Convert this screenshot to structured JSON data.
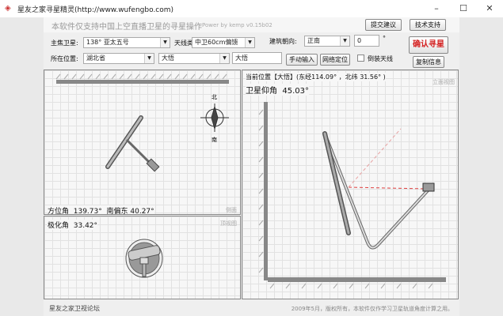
{
  "window": {
    "title": "星友之家寻星精灵(http://www.wufengbo.com)",
    "minimize": "–",
    "maximize": "☐",
    "close": "✕"
  },
  "header": {
    "slogan": "本软件仅支持中国上空直播卫星的寻星操作",
    "power": "Power by kemp  v0.15b02",
    "suggest_button": "提交建议",
    "support_button": "技术支持"
  },
  "controls": {
    "satellite_label": "主焦卫星:",
    "satellite_value": "138°  亚太五号",
    "antenna_label": "天线类型:",
    "antenna_value": "中卫60cm偏馈",
    "facing_label": "建筑朝向:",
    "facing_value": "正南",
    "facing_degree": "0",
    "degree_unit": "°",
    "confirm_button": "确认寻星",
    "location_label": "所在位置:",
    "province_value": "湖北省",
    "city_value": "大悟",
    "city_input": "大悟",
    "manual_button": "手动输入",
    "network_button": "网络定位",
    "inverted_label": "倒装天线",
    "inverted_checked": false,
    "copy_button": "复制信息"
  },
  "side_view": {
    "tag": "侧面",
    "azimuth_label": "方位角",
    "azimuth_value": "139.73°",
    "offset_label": "南偏东",
    "offset_value": "40.27°",
    "compass_n": "北",
    "compass_s": "南"
  },
  "top_view": {
    "tag": "顶视图",
    "polarization_label": "极化角",
    "polarization_value": "33.42°"
  },
  "elevation_view": {
    "tag": "立面视图",
    "location_text": "当前位置【大悟】(东经114.09° ，北纬 31.56° )",
    "elevation_label": "卫星仰角",
    "elevation_value": "45.03°"
  },
  "footer": {
    "forum": "星友之家卫视论坛",
    "copyright": "2009年5月，版权所有，本软件仅作学习卫星轨道角度计算之用。"
  },
  "colors": {
    "confirm_text": "#d42020",
    "arrow": "#e04040"
  }
}
